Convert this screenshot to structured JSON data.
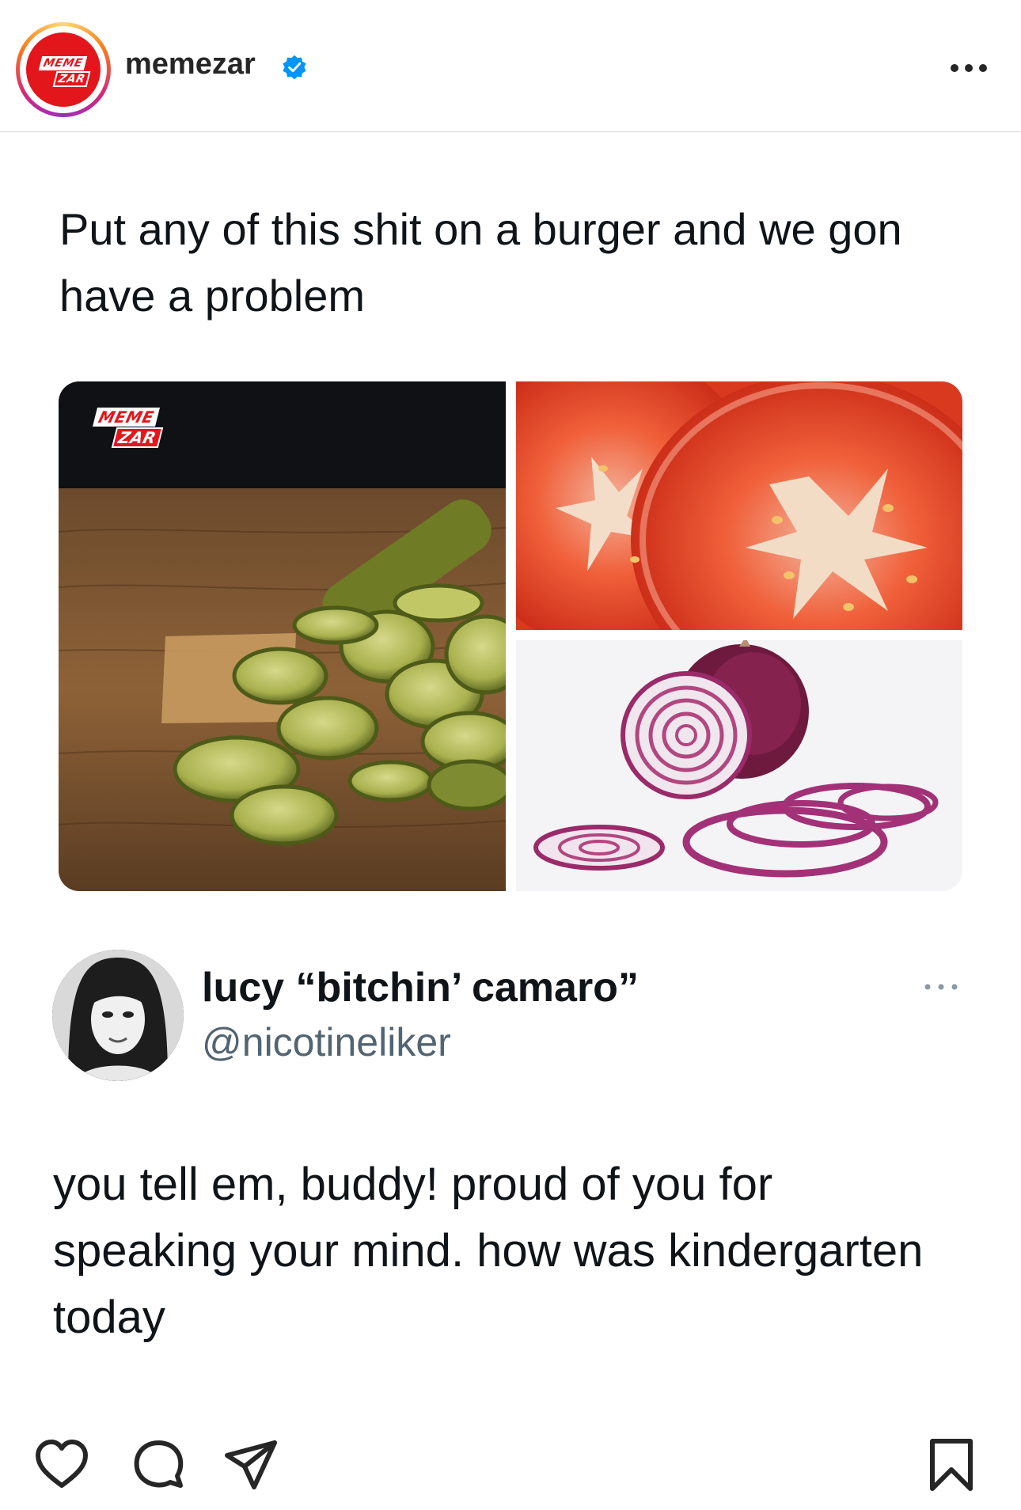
{
  "header": {
    "avatar_logo": {
      "line1": "MEME",
      "line2": "ZAR"
    },
    "username": "memezar",
    "verified_icon": "verified-badge-icon",
    "more_icon": "more-horizontal-icon"
  },
  "post": {
    "text": "Put any of this shit on a burger and we gon have a problem",
    "watermark": {
      "line1": "MEME",
      "line2": "ZAR"
    },
    "images": [
      "pickles-photo",
      "tomato-slices-photo",
      "red-onion-photo"
    ]
  },
  "reply": {
    "display_name": "lucy “bitchin’ camaro”",
    "handle": "@nicotineliker",
    "text": "you tell em, buddy! proud of you for speaking your mind. how was kindergarten today",
    "more_icon": "more-horizontal-icon"
  },
  "actions": {
    "icons": [
      "heart-icon",
      "comment-icon",
      "share-icon",
      "bookmark-icon"
    ]
  },
  "colors": {
    "brand_red": "#e3161c",
    "verified_blue": "#0095f6",
    "text_primary": "#0f1419",
    "text_secondary": "#536471"
  }
}
